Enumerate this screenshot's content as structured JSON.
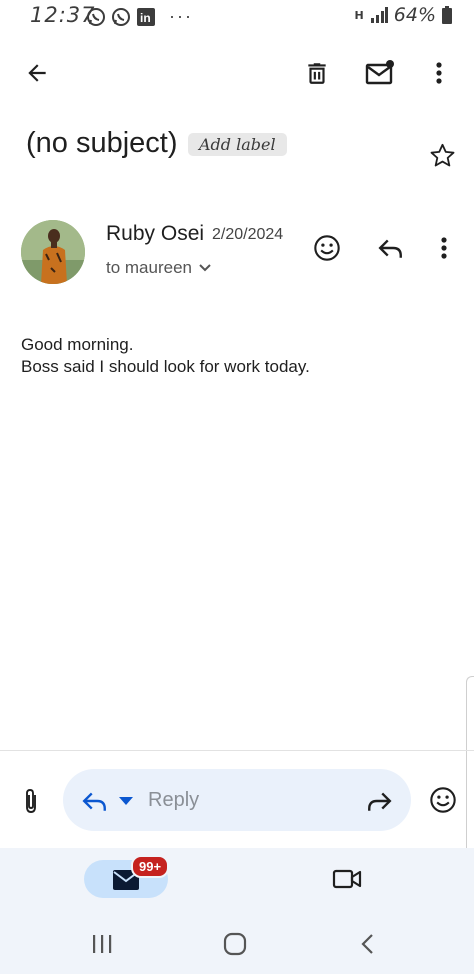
{
  "status_bar": {
    "time": "12:37",
    "network": "H",
    "battery": "64%"
  },
  "toolbar": {
    "back": "back-icon",
    "delete": "delete-icon",
    "mark_unread": "mark-unread-icon",
    "more": "more-icon"
  },
  "email": {
    "subject": "(no subject)",
    "add_label": "Add label",
    "sender": "Ruby Osei",
    "date": "2/20/2024",
    "to": "to maureen",
    "body_lines": [
      "Good morning.",
      "Boss said I should look for work today."
    ]
  },
  "composer": {
    "reply_placeholder": "Reply"
  },
  "bottom_nav": {
    "mail_badge": "99+"
  },
  "colors": {
    "accent": "#0b57d0",
    "reply_bg": "#eaf1fb",
    "nav_bg": "#f0f4fa",
    "pill_bg": "#c8e1fb",
    "badge": "#c5221f"
  }
}
